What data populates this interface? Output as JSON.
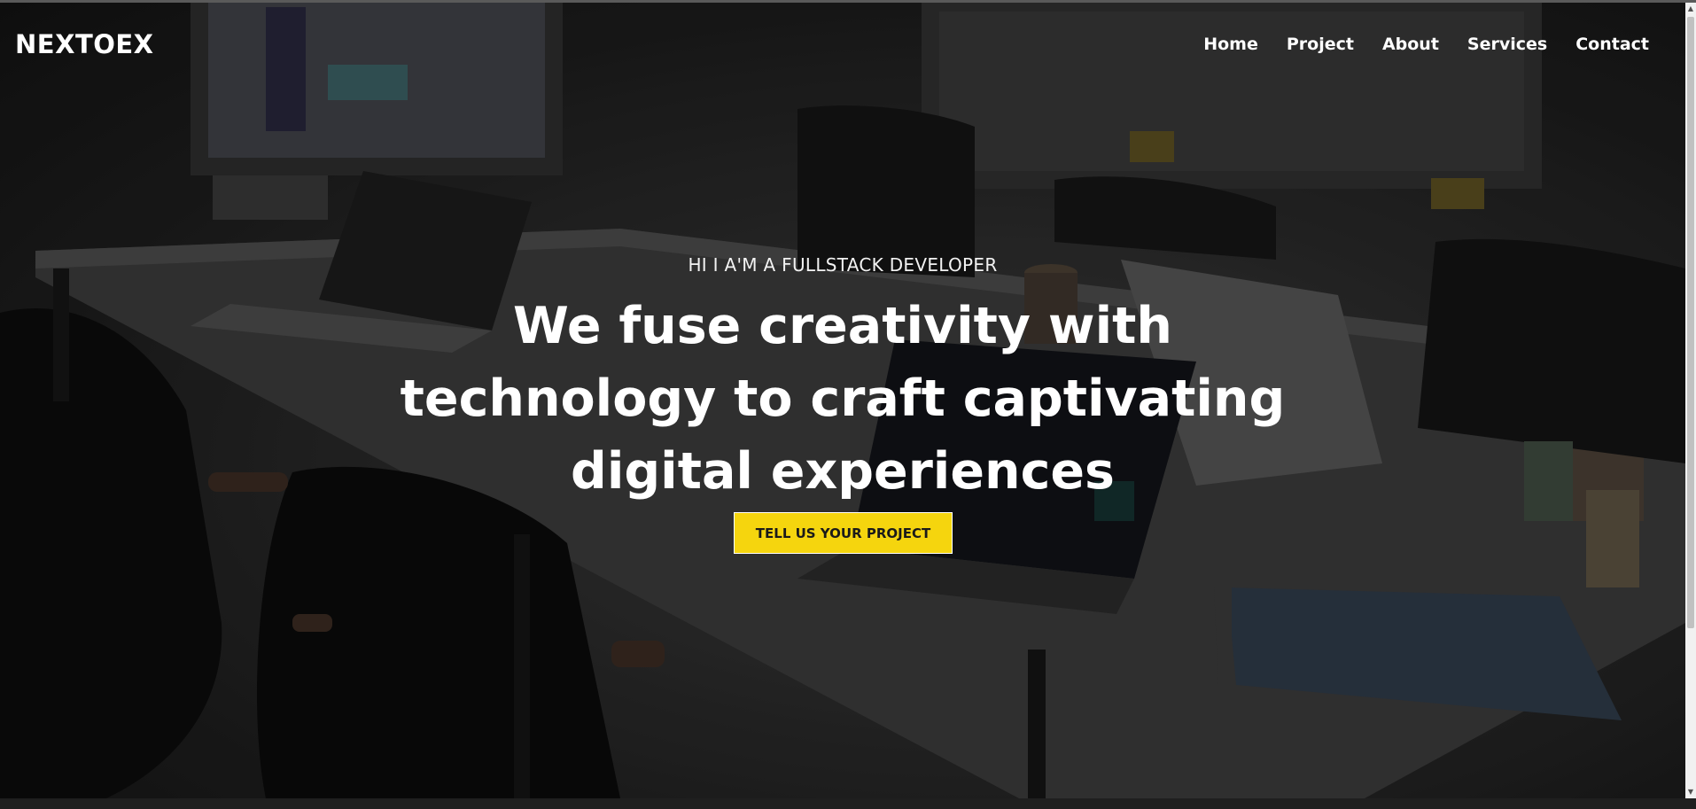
{
  "brand": {
    "logo": "NEXTOEX"
  },
  "nav": {
    "items": [
      {
        "label": "Home"
      },
      {
        "label": "Project"
      },
      {
        "label": "About"
      },
      {
        "label": "Services"
      },
      {
        "label": "Contact"
      }
    ]
  },
  "hero": {
    "subtitle": "HI I A'M A FULLSTACK DEVELOPER",
    "headline_lines": [
      "We fuse creativity with",
      "technology to craft captivating",
      "digital experiences"
    ],
    "cta_label": "TELL US YOUR PROJECT",
    "background_image": "office-meeting-room-photo"
  },
  "colors": {
    "accent": "#f5d50e",
    "text": "#ffffff",
    "overlay": "#000000"
  },
  "scrollbar": {
    "up_icon": "▲",
    "down_icon": "▼"
  }
}
